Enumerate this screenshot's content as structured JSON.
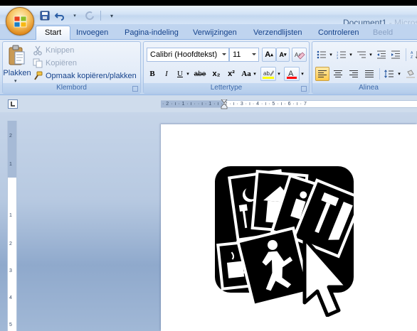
{
  "window": {
    "doc_name": "Document1",
    "app_name_fragment": " - Micros"
  },
  "qat": {
    "items": [
      "save",
      "undo",
      "redo",
      "customize"
    ]
  },
  "tabs": [
    {
      "label": "Start",
      "active": true
    },
    {
      "label": "Invoegen",
      "active": false
    },
    {
      "label": "Pagina-indeling",
      "active": false
    },
    {
      "label": "Verwijzingen",
      "active": false
    },
    {
      "label": "Verzendlijsten",
      "active": false
    },
    {
      "label": "Controleren",
      "active": false
    },
    {
      "label": "Beeld",
      "active": false
    }
  ],
  "ribbon": {
    "clipboard": {
      "paste_label": "Plakken",
      "cut_label": "Knippen",
      "copy_label": "Kopiëren",
      "format_painter_label": "Opmaak kopiëren/plakken",
      "group_label": "Klembord"
    },
    "font": {
      "font_name": "Calibri (Hoofdtekst)",
      "font_size": "11",
      "bold": "B",
      "italic": "I",
      "underline": "U",
      "strikethrough": "abe",
      "subscript": "x₂",
      "superscript": "x²",
      "change_case": "Aa",
      "group_label": "Lettertype"
    },
    "paragraph": {
      "group_label": "Alinea"
    }
  },
  "ruler": {
    "horizontal_marks": "· 2 · ı · 1 · ı ·  · ı · 1 · ı · 2 · ı · 3 · ı · 4 · ı · 5 · ı · 6 · ı · 7",
    "vertical_marks": [
      "2",
      "1",
      "1",
      "2",
      "3",
      "4",
      "5"
    ]
  },
  "colors": {
    "accent": "#15428b",
    "highlight": "#ffff00",
    "font_color": "#ff0000"
  }
}
